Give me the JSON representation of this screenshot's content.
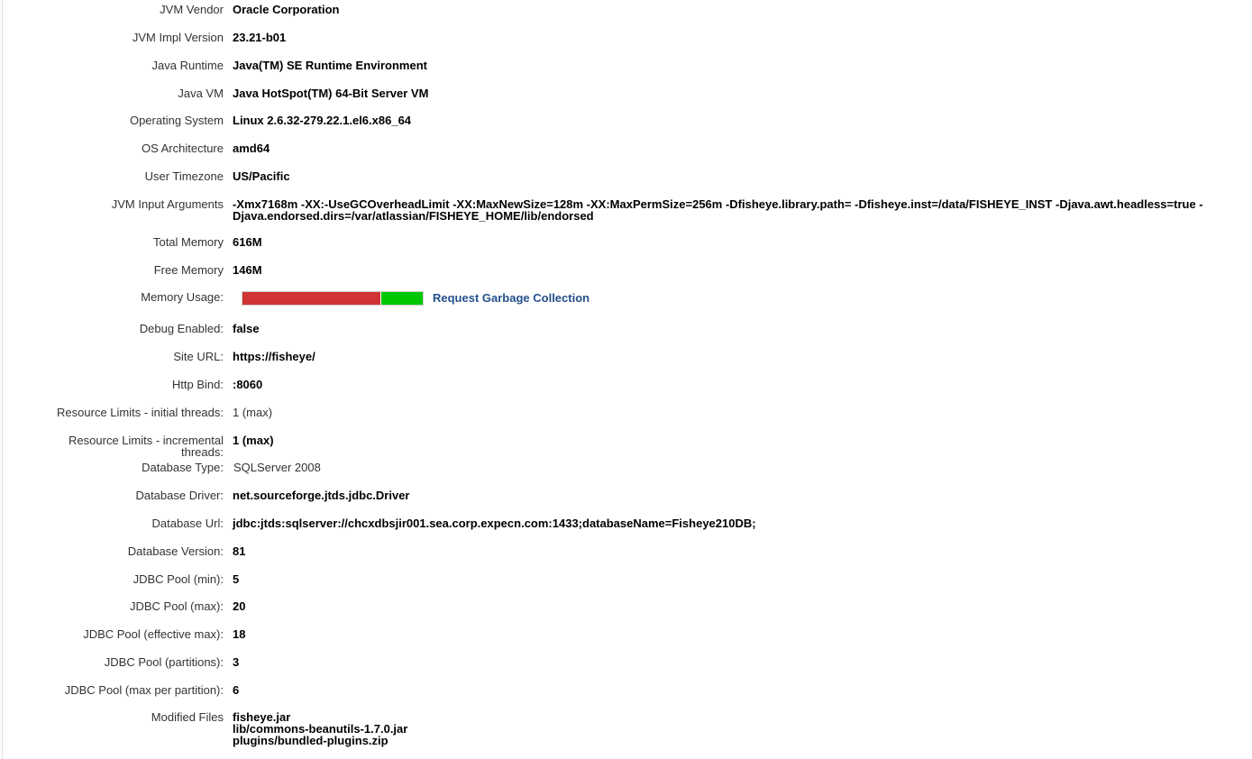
{
  "rows": [
    {
      "label": "JVM Vendor",
      "value": "Oracle Corporation"
    },
    {
      "label": "JVM Impl Version",
      "value": "23.21-b01"
    },
    {
      "label": "Java Runtime",
      "value": "Java(TM) SE Runtime Environment"
    },
    {
      "label": "Java VM",
      "value": "Java HotSpot(TM) 64-Bit Server VM"
    },
    {
      "label": "Operating System",
      "value": "Linux 2.6.32-279.22.1.el6.x86_64"
    },
    {
      "label": "OS Architecture",
      "value": "amd64"
    },
    {
      "label": "User Timezone",
      "value": "US/Pacific"
    },
    {
      "label": "JVM Input Arguments",
      "value": "-Xmx7168m -XX:-UseGCOverheadLimit -XX:MaxNewSize=128m -XX:MaxPermSize=256m -Dfisheye.library.path= -Dfisheye.inst=/data/FISHEYE_INST -Djava.awt.headless=true -Djava.endorsed.dirs=/var/atlassian/FISHEYE_HOME/lib/endorsed"
    },
    {
      "label": "Total Memory",
      "value": "616M"
    },
    {
      "label": "Free Memory",
      "value": "146M"
    },
    {
      "label": "Memory Usage:",
      "value": ""
    },
    {
      "label": "Debug Enabled:",
      "value": "false"
    },
    {
      "label": "Site URL:",
      "value": "https://fisheye/"
    },
    {
      "label": "Http Bind:",
      "value": ":8060"
    },
    {
      "label": "Resource Limits - initial threads:",
      "value": "1 (max)"
    },
    {
      "label": "Resource Limits - incremental threads:",
      "value": "1 (max)"
    },
    {
      "label": "Database Type:",
      "value": "SQLServer 2008"
    },
    {
      "label": "Database Driver:",
      "value": "net.sourceforge.jtds.jdbc.Driver"
    },
    {
      "label": "Database Url:",
      "value": "jdbc:jtds:sqlserver://chcxdbsjir001.sea.corp.expecn.com:1433;databaseName=Fisheye210DB;"
    },
    {
      "label": "Database Version:",
      "value": "81"
    },
    {
      "label": "JDBC Pool (min):",
      "value": "5"
    },
    {
      "label": "JDBC Pool (max):",
      "value": "20"
    },
    {
      "label": "JDBC Pool (effective max):",
      "value": "18"
    },
    {
      "label": "JDBC Pool (partitions):",
      "value": "3"
    },
    {
      "label": "JDBC Pool (max per partition):",
      "value": "6"
    },
    {
      "label": "Modified Files",
      "value": ""
    }
  ],
  "memory_usage": {
    "used_fraction": 0.763,
    "used_color": "#d03434",
    "free_color": "#00c800",
    "gc_link_label": "Request Garbage Collection"
  },
  "modified_files": [
    "fisheye.jar",
    "lib/commons-beanutils-1.7.0.jar",
    "plugins/bundled-plugins.zip"
  ]
}
